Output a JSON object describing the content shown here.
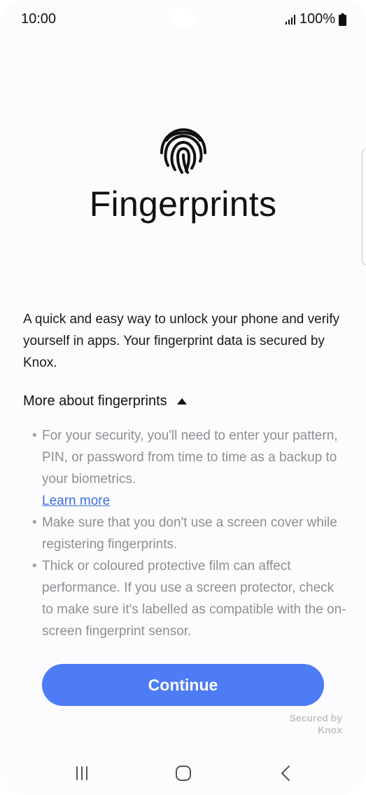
{
  "status_bar": {
    "time": "10:00",
    "battery_text": "100%",
    "icons": [
      "signal-icon",
      "battery-icon"
    ]
  },
  "header": {
    "icon": "fingerprint-icon",
    "title": "Fingerprints"
  },
  "description": "A quick and easy way to unlock your phone and verify yourself in apps. Your fingerprint data is secured by Knox.",
  "more_about": {
    "label": "More about fingerprints",
    "expanded_icon": "caret-up-icon",
    "bullets": [
      "For your security, you'll need to enter your pattern, PIN, or password from time to time as a backup to your biometrics.",
      "Make sure that you don't use a screen cover while registering fingerprints.",
      "Thick or coloured protective film can affect performance. If you use a screen protector, check to make sure it's labelled as compatible with the on-screen fingerprint sensor."
    ],
    "learn_more": "Learn more"
  },
  "continue_label": "Continue",
  "secured_by": {
    "line1": "Secured by",
    "line2": "Knox"
  },
  "nav_bar": {
    "icons": [
      "recents-icon",
      "home-icon",
      "back-icon"
    ]
  },
  "colors": {
    "accent": "#4d7cf5",
    "link": "#3e6fd8",
    "muted_text": "#8e8e93"
  }
}
